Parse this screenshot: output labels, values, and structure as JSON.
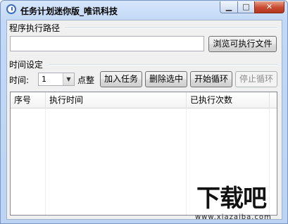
{
  "window": {
    "title": "任务计划迷你版_唯讯科技",
    "min_label": "▁",
    "max_label": "□",
    "close_label": "✕",
    "app_icon": "clock-icon"
  },
  "path_section": {
    "label": "程序执行路径",
    "path_value": "",
    "browse_button": "浏览可执行文件"
  },
  "time_section": {
    "label": "时间设定",
    "time_label": "时间:",
    "time_value": "1",
    "unit_label": "点整",
    "add_button": "加入任务",
    "delete_button": "删除选中",
    "start_button": "开始循环",
    "stop_button": "停止循环"
  },
  "task_list": {
    "columns": [
      "序号",
      "执行时间",
      "已执行次数"
    ],
    "rows": []
  },
  "watermark": {
    "main": "下载吧",
    "sub": "www.xiazaiba.com"
  },
  "colors": {
    "title_bar": "#c2d8f6",
    "close_button": "#c94a30",
    "client_bg": "#f0f0f0"
  }
}
